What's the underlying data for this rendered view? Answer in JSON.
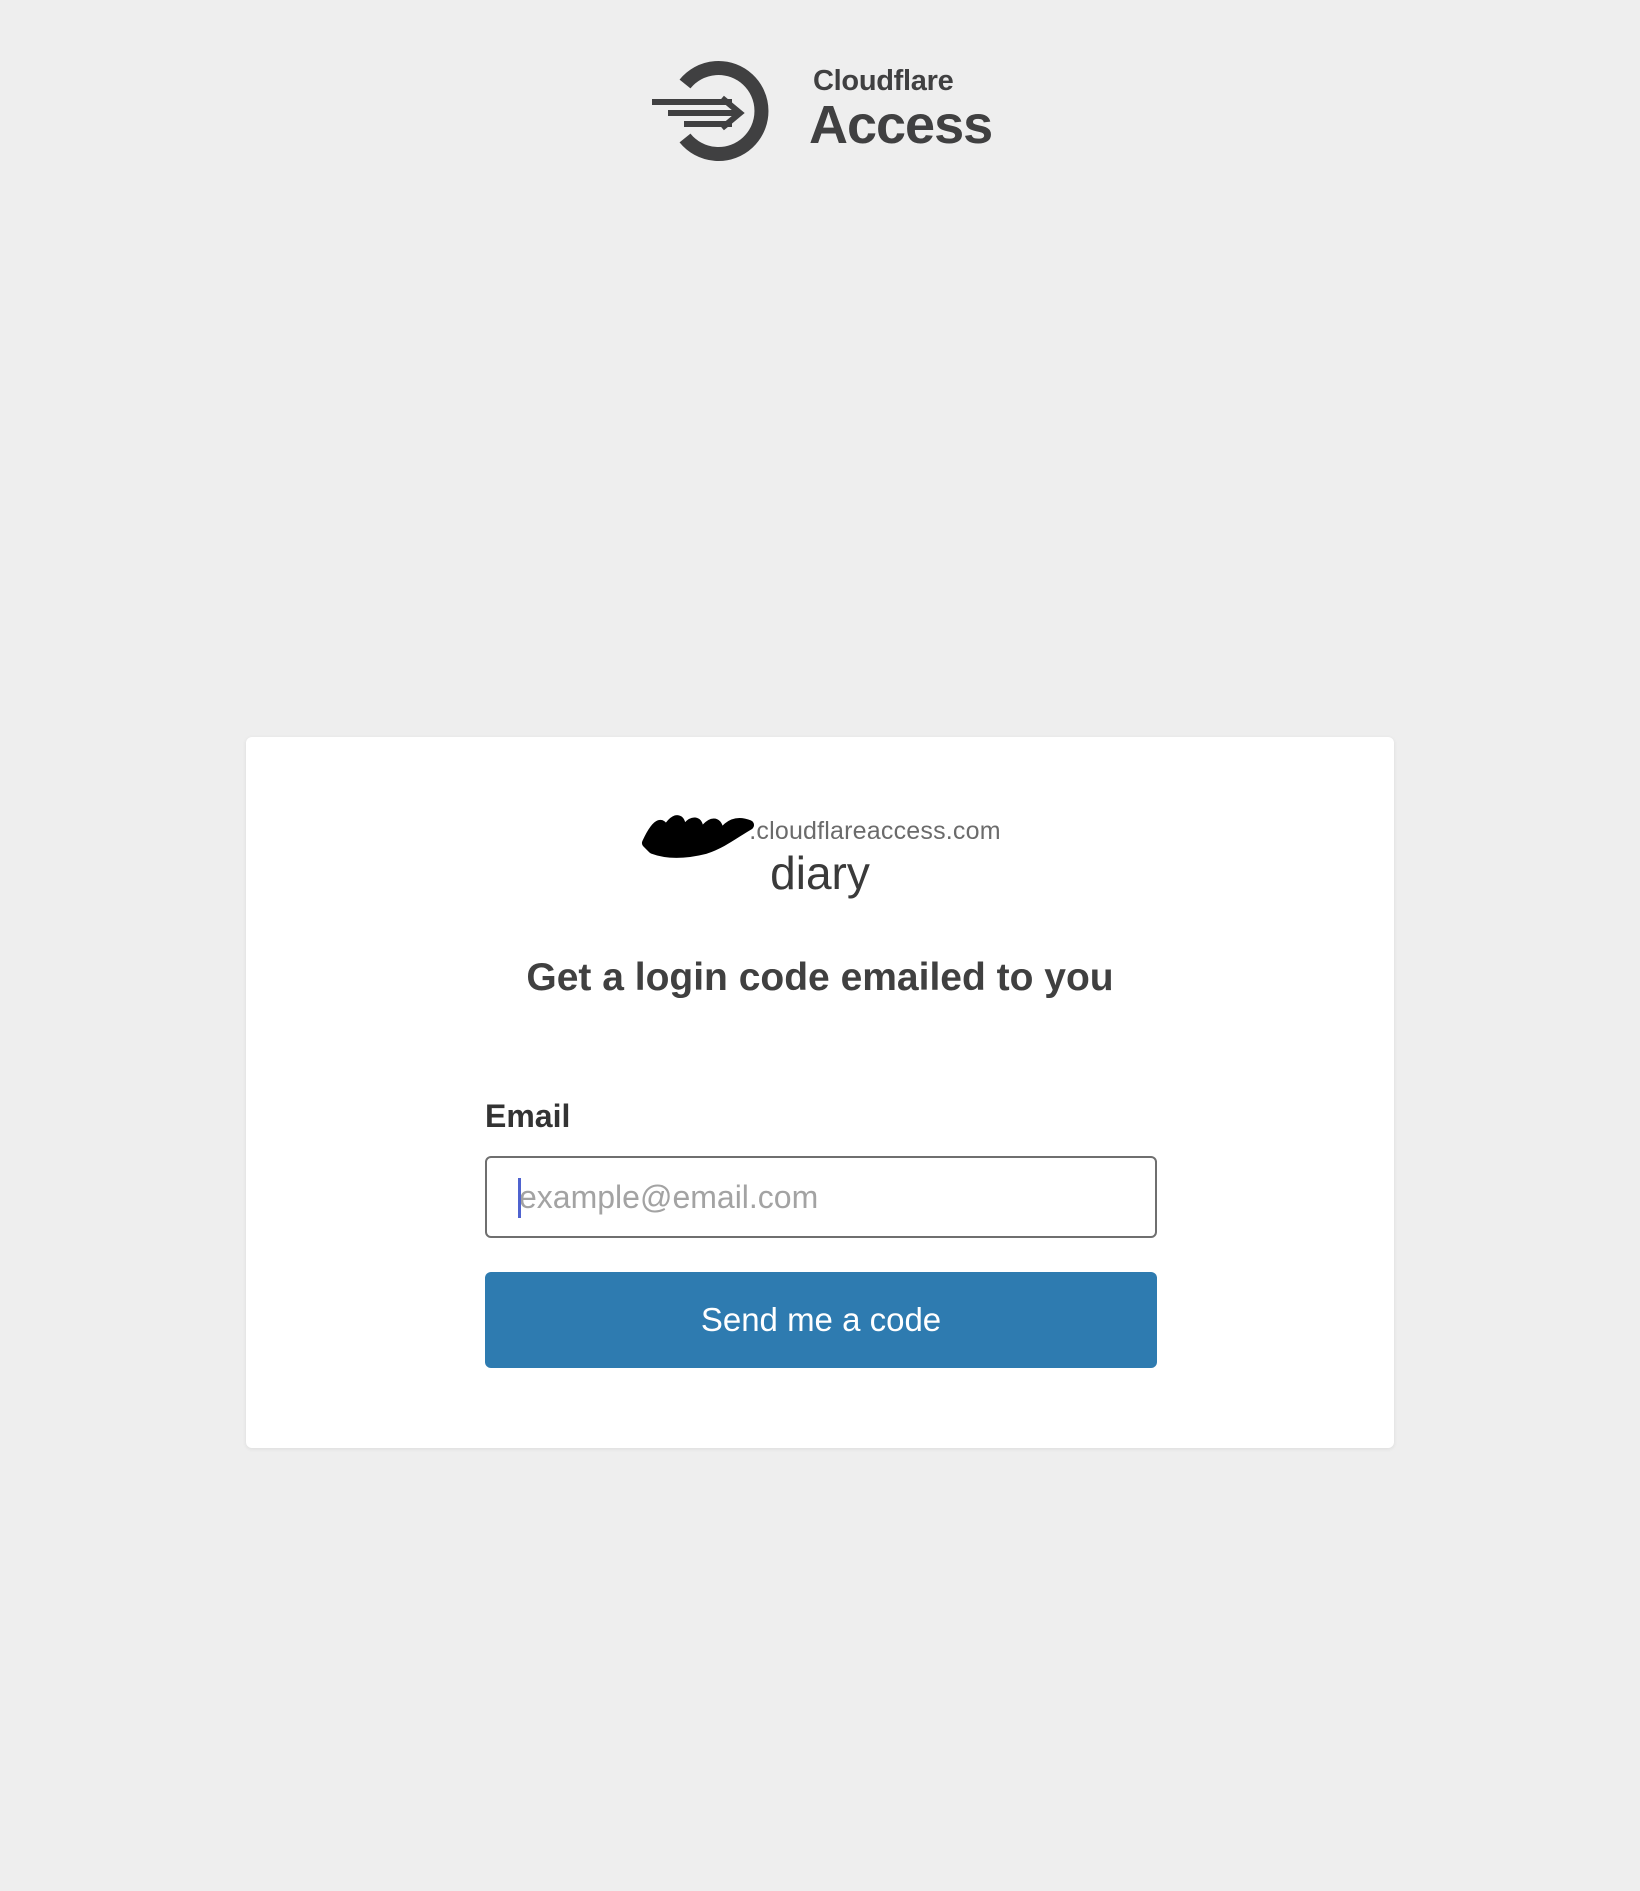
{
  "header": {
    "logo_line1": "Cloudflare",
    "logo_line2": "Access"
  },
  "card": {
    "domain_suffix": ".cloudflareaccess.com",
    "app_name": "diary",
    "title": "Get a login code emailed to you",
    "email_label": "Email",
    "email_placeholder": "example@email.com",
    "email_value": "",
    "send_button_label": "Send me a code"
  },
  "colors": {
    "page_background": "#eeeeee",
    "card_background": "#ffffff",
    "button_background": "#2e7bb0",
    "logo_color": "#404041"
  },
  "icons": {
    "logo": "cloudflare-access-logo-icon",
    "redaction": "redaction-scribble-icon"
  }
}
